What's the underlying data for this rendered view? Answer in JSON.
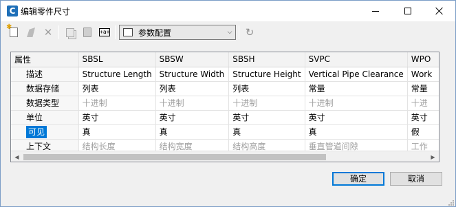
{
  "window": {
    "title": "编辑零件尺寸",
    "app_icon_letter": "C"
  },
  "toolbar": {
    "config_select_value": "参数配置",
    "icons": [
      "new-icon",
      "edit-icon",
      "delete-icon",
      "copy-icon",
      "paste-icon",
      "rename-icon",
      "config-icon",
      "chevron-down-icon",
      "sync-icon"
    ],
    "delete_glyph": "✕",
    "rename_glyph": "+a+",
    "sync_glyph": "↻",
    "arrow_glyph": "⌵"
  },
  "grid": {
    "columns": [
      "属性",
      "SBSL",
      "SBSW",
      "SBSH",
      "SVPC",
      "WPO"
    ],
    "rows": [
      {
        "label": "描述",
        "cells": [
          "Structure Length",
          "Structure Width",
          "Structure Height",
          "Vertical Pipe Clearance",
          "Work"
        ],
        "gray": false
      },
      {
        "label": "数据存储",
        "cells": [
          "列表",
          "列表",
          "列表",
          "常量",
          "常量"
        ],
        "gray": false
      },
      {
        "label": "数据类型",
        "cells": [
          "十进制",
          "十进制",
          "十进制",
          "十进制",
          "十进"
        ],
        "gray": true
      },
      {
        "label": "单位",
        "cells": [
          "英寸",
          "英寸",
          "英寸",
          "英寸",
          "英寸"
        ],
        "gray": false
      },
      {
        "label": "可见",
        "cells": [
          "真",
          "真",
          "真",
          "真",
          "假"
        ],
        "gray": false,
        "selected": true
      },
      {
        "label": "上下文",
        "cells": [
          "结构长度",
          "结构宽度",
          "结构高度",
          "垂直管道间隙",
          "工作"
        ],
        "gray": true
      }
    ]
  },
  "buttons": {
    "ok": "确定",
    "cancel": "取消"
  },
  "colors": {
    "selection": "#0078d7",
    "window_bg": "#f0f0f0"
  }
}
